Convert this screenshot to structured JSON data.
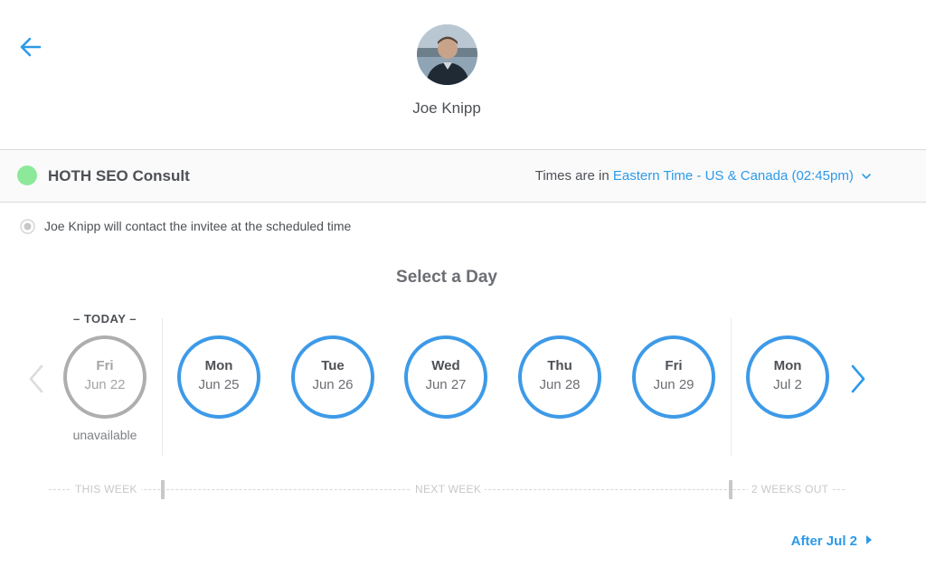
{
  "host": {
    "name": "Joe Knipp"
  },
  "event": {
    "name": "HOTH SEO Consult",
    "status_color": "#8ce99a",
    "timezone_prefix": "Times are in",
    "timezone_link": "Eastern Time - US & Canada (02:45pm)",
    "location_note": "Joe Knipp will contact the invitee at the scheduled time"
  },
  "calendar": {
    "title": "Select a Day",
    "today_label": "– TODAY –",
    "days": [
      {
        "dow": "Fri",
        "date": "Jun 22",
        "available": false,
        "note": "unavailable"
      },
      {
        "dow": "Mon",
        "date": "Jun 25",
        "available": true
      },
      {
        "dow": "Tue",
        "date": "Jun 26",
        "available": true
      },
      {
        "dow": "Wed",
        "date": "Jun 27",
        "available": true
      },
      {
        "dow": "Thu",
        "date": "Jun 28",
        "available": true
      },
      {
        "dow": "Fri",
        "date": "Jun 29",
        "available": true
      },
      {
        "dow": "Mon",
        "date": "Jul 2",
        "available": true
      }
    ],
    "weeks": [
      "THIS WEEK",
      "NEXT WEEK",
      "2 WEEKS OUT"
    ],
    "after_link": "After Jul 2"
  },
  "colors": {
    "accent": "#2d9ae8",
    "ring": "#3d9ae8",
    "unavailable_ring": "#aeaeae",
    "available_dot": "#8ce99a"
  },
  "icons": [
    "back-arrow-icon",
    "avatar-photo",
    "chevron-down-icon",
    "phone-location-icon",
    "chevron-left-icon",
    "chevron-right-icon",
    "caret-right-icon"
  ]
}
